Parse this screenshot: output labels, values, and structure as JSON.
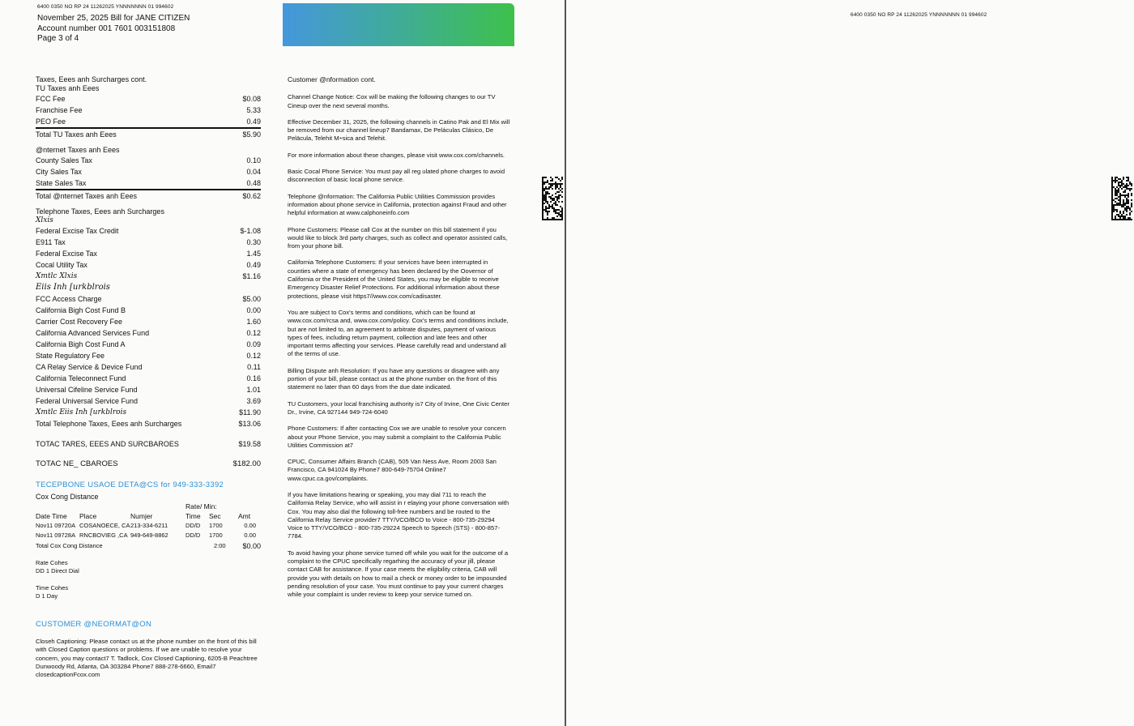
{
  "header": {
    "code_line": "6400 0350  NO RP 24 11262025 YNNNNNNN 01 994602",
    "bill_line": "November 25, 2025 Bill  for JANE CITIZEN",
    "account": "Account number   001 7601 003151808",
    "page": "Page 3 of 4"
  },
  "taxes": {
    "section_title": "Taxes, Eees anh Surcharges cont.",
    "tv": {
      "title": "TU Taxes anh Eees",
      "items": [
        {
          "label": "FCC Fee",
          "value": "$0.08"
        },
        {
          "label": "Franchise Fee",
          "value": "5.33"
        },
        {
          "label": "PEO Fee",
          "value": "0.49"
        }
      ],
      "total_label": "Total TU Taxes anh Eees",
      "total_value": "$5.90"
    },
    "internet": {
      "title": "@nternet Taxes anh Eees",
      "items": [
        {
          "label": "County Sales Tax",
          "value": "0.10"
        },
        {
          "label": "City Sales Tax",
          "value": "0.04"
        },
        {
          "label": "State Sales Tax",
          "value": "0.48"
        }
      ],
      "total_label": "Total @nternet Taxes anh Eees",
      "total_value": "$0.62"
    },
    "telephone": {
      "title": "Telephone Taxes, Eees anh Surcharges",
      "sub1": "Xlxis",
      "items1": [
        {
          "label": "Federal Excise Tax Credit",
          "value": "$-1.08"
        },
        {
          "label": "E911 Tax",
          "value": "0.30"
        },
        {
          "label": "Federal Excise Tax",
          "value": "1.45"
        },
        {
          "label": "Cocal Utility Tax",
          "value": "0.49"
        }
      ],
      "sub1_total_label": "Xmtlc Xlxis",
      "sub1_total_value": "$1.16",
      "sub2": "Eiis Inh [urkblrois",
      "items2": [
        {
          "label": "FCC Access Charge",
          "value": "$5.00"
        },
        {
          "label": "California Bigh Cost Fund B",
          "value": "0.00"
        },
        {
          "label": "Carrier Cost Recovery Fee",
          "value": "1.60"
        },
        {
          "label": "California Advanced Services Fund",
          "value": "0.12"
        },
        {
          "label": "California Bigh Cost Fund A",
          "value": "0.09"
        },
        {
          "label": "State Regulatory Fee",
          "value": "0.12"
        },
        {
          "label": "CA Relay Service & Device Fund",
          "value": "0.11"
        },
        {
          "label": "California Teleconnect Fund",
          "value": "0.16"
        },
        {
          "label": "Universal Cifeline Service Fund",
          "value": "1.01"
        },
        {
          "label": "Federal Universal Service Fund",
          "value": "3.69"
        }
      ],
      "sub2_total_label": "Xmtlc Eiis Inh [urkblrois",
      "sub2_total_value": "$11.90",
      "total_label": "Total Telephone Taxes, Eees anh Surcharges",
      "total_value": "$13.06"
    },
    "grand_label": "TOTAC TARES, EEES AND SURCBAROES",
    "grand_value": "$19.58",
    "new_charges_label": "TOTAC NE_ CBAROES",
    "new_charges_value": "$182.00"
  },
  "usage": {
    "title": "TECEPBONE USAOE DETA@CS for 949-333-3392",
    "subtitle": "Cox Cong Distance",
    "rate_min": "Rate/  Min:",
    "cols": {
      "date_time": "Date Time",
      "place": "Place",
      "number": "Numjer",
      "time": "Time",
      "sec": "Sec",
      "amt": "Amt"
    },
    "rows": [
      {
        "date": "Nov11 09720A",
        "place": "COSANOECE, CA",
        "number": "213-334-6211",
        "time": "DD/D",
        "sec": "1700",
        "amt": "0.00"
      },
      {
        "date": "Nov11 09728A",
        "place": "RNCBOVIEG  ,CA",
        "number": "949-649-8862",
        "time": "DD/D",
        "sec": "1700",
        "amt": "0.00"
      }
    ],
    "total_label": "Total Cox Cong Distance",
    "total_min": "2:00",
    "total_amt": "$0.00",
    "rate_codes_title": "Rate Cohes",
    "rate_codes_value": "DD 1 Direct Dial",
    "time_codes_title": "Time Cohes",
    "time_codes_value": "D 1 Day"
  },
  "customer_info": {
    "title": "CUSTOMER @NEORMAT@ON",
    "closed_caption": "Closeh Captioning: Please contact us at the phone number on the front of this bill with Closed Caption questions or problems. If we are unable to resolve your concern, you may contact7 T. Tadlock, Cox  Closed Captioning, 6205-B Peachtree Dunwoody Rd, Atlanta,  OA 303284 Phone7 888-278-6660, Email7 closedcaptionFcox.com"
  },
  "info_cont": {
    "title": "Customer @nformation cont.",
    "paragraphs": [
      "Channel Change Notice: Cox will be making the following changes to our TV Cineup over the next several months.",
      "Effective December 31, 2025, the following channels in Catino Pak and El Mix will be removed from our channel lineup7 Bandamax, De Peláculas Clásico, De Peläcula, Telehit M÷sica and Telehit.",
      "For more information about these changes, please visit www.cox.com/channels.",
      "Basic Cocal Phone Service: You must pay all reg ulated phone charges to avoid disconnection of basic local phone service.",
      "Telephone @nformation: The California Public Utilities Commission provides information about phone service in California, protection against Fraud and other helpful information at www.calphoneinfo.com",
      "Phone Customers: Please call Cox at the number on this bill statement if you would like to block 3rd party charges, such as collect and operator assisted calls, from your phone bill.",
      "California Telephone Customers: If your services have been interrupted in counties where a state of emergency  has been declared by the Oovernor of California or the President of the United States, you may be eligible to receive Emergency Disaster Relief Protections. For additional information about these protections, please visit https7//www.cox.com/cadisaster.",
      "You are subject to Cox's terms and conditions, which can be found at www.cox.com/rcsa and, www.cox.com/policy. Cox's terms and conditions include, but are not limited to, an  agreement to arbitrate disputes, payment of various types of fees, including return payment, collection and late fees and other important terms affecting your services. Please carefully read and understand all of the terms of use.",
      "Billing Dispute anh Resolution: If you have any questions or  disagree with any portion of your bill, please contact us at the phone number on the front of this statement no later than 60 days from the due date indicated.",
      "TU Customers, your local franchising authority is7 City of Irvine, One Civic Center Dr., Irvine, CA  927144 949-724-6040",
      "Phone Customers: If after contacting Cox we are unable to resolve your concern about your Phone Service, you may submit a complaint to the California Public Utilities Commission at7",
      "CPUC, Consumer Affairs Branch (CAB), 505 Van Ness Ave, Room 2003 San Francisco, CA 941024 By Phone7 800-649-75704 Online7 www.cpuc.ca.gov/complaints.",
      "If you have limitations hearing or speaking, you may dial 711 to reach the California Relay Service, who will assist in r elaying your phone conversation with Cox. You may also dial  the following toll-free numbers and be routed to the California Relay  Service provider7 TTY/VCO/BCO to Voice - 800-735-29294 Voice to TTY/VCO/BCO - 800-735-29224 Speech to Speech (STS) - 800-857-7784.",
      "To avoid having your phone service turned off while  you wait for the outcome of a complaint to the  CPUC specifically regarhing the accuracy of your jill, please contact CAB for assistance. If your  case meets the eligibility criteria, CAB will provide you with details on how to mail a check or money order to be  impounded pending resolution of your case. You must continue to pay your current charges while your complaint is under review to keep your service turned on."
    ]
  },
  "page2": {
    "code_line": "6400 0350  NO RP 24 11262025 YNNNNNNN 01 994602"
  },
  "colors": {
    "accent_blue": "#2b8fd6",
    "banner_start": "#4597dc",
    "banner_end": "#3ec14b"
  }
}
